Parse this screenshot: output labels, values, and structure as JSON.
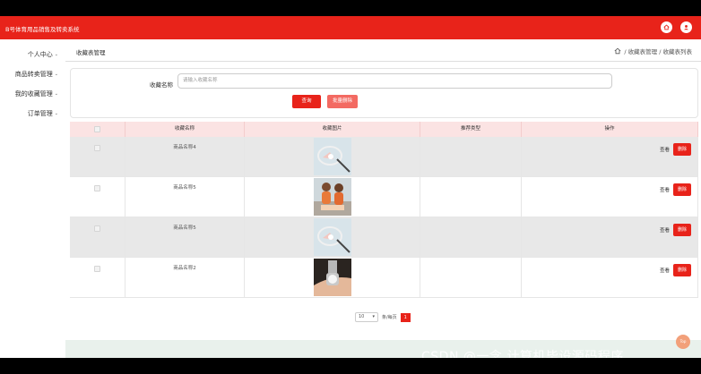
{
  "app": {
    "title": "B号体育用品销售及转卖系统"
  },
  "sidebar": {
    "items": [
      {
        "label": "个人中心"
      },
      {
        "label": "商品转卖管理"
      },
      {
        "label": "我的收藏管理"
      },
      {
        "label": "订单管理"
      }
    ]
  },
  "breadcrumb": {
    "left": "收藏表管理",
    "right": "/ 收藏表管理 / 收藏表列表"
  },
  "search": {
    "label": "收藏名称",
    "placeholder": "请输入收藏名称",
    "search_button": "查询",
    "batch_delete_button": "批量删除"
  },
  "table": {
    "columns": [
      "收藏名称",
      "收藏图片",
      "推荐类型",
      "操作"
    ],
    "rows": [
      {
        "name": "商品名称4",
        "image": "badminton-racket"
      },
      {
        "name": "商品名称5",
        "image": "people-photo"
      },
      {
        "name": "商品名称5",
        "image": "badminton-racket"
      },
      {
        "name": "商品名称2",
        "image": "wrist-watch"
      }
    ],
    "view_label": "查看",
    "delete_label": "删除"
  },
  "pagination": {
    "page_size": "10",
    "per_page_label": "条/每页",
    "current_page": "1"
  },
  "watermark": "CSDN @一念 计算机毕设源码程序",
  "float_button": "Top",
  "colors": {
    "accent": "#e8231a",
    "header_bg": "#fbe3e3"
  }
}
